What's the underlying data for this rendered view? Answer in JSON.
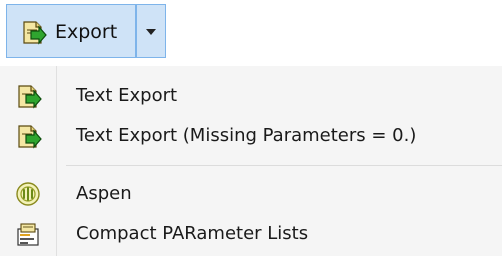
{
  "toolbar": {
    "export_button": {
      "label": "Export",
      "icon": "export-icon",
      "has_dropdown": true
    },
    "colors": {
      "button_bg": "#cfe3f7",
      "button_border": "#7eb4ea"
    }
  },
  "menu": {
    "items": [
      {
        "label": "Text Export",
        "icon": "text-export-icon"
      },
      {
        "label": "Text Export (Missing Parameters = 0.)",
        "icon": "text-export-missing-icon"
      },
      {
        "separator": true
      },
      {
        "label": "Aspen",
        "icon": "aspen-icon"
      },
      {
        "label": "Compact PARameter Lists",
        "icon": "compact-parameter-lists-icon"
      }
    ]
  }
}
